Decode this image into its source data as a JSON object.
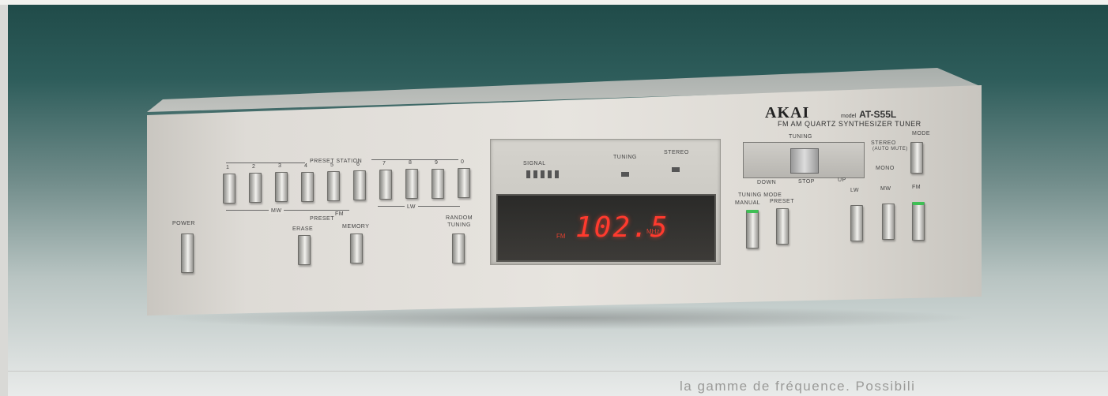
{
  "device": {
    "brand": "AKAI",
    "model_prefix": "model",
    "model": "AT-S55L",
    "subtitle": "FM AM QUARTZ SYNTHESIZER TUNER"
  },
  "labels": {
    "preset_station": "PRESET STATION",
    "power": "POWER",
    "preset": "PRESET",
    "erase": "ERASE",
    "memory": "MEMORY",
    "random_tuning": "RANDOM TUNING",
    "mw": "MW",
    "fm": "FM",
    "lw": "LW",
    "signal": "SIGNAL",
    "tuning": "TUNING",
    "stereo": "STEREO",
    "tuning_dial": "TUNING",
    "down": "DOWN",
    "stop": "STOP",
    "up": "UP",
    "tuning_mode": "TUNING MODE",
    "manual": "MANUAL",
    "preset_mode": "PRESET",
    "mode": "MODE",
    "stereo_mode": "STEREO",
    "auto_mute": "(AUTO MUTE)",
    "mono": "MONO",
    "band_lw": "LW",
    "band_mw": "MW",
    "band_fm": "FM"
  },
  "preset_numbers": [
    "1",
    "2",
    "3",
    "4",
    "5",
    "6",
    "7",
    "8",
    "9",
    "0"
  ],
  "display": {
    "band": "FM",
    "frequency": "102.5",
    "unit": "MHz"
  },
  "caption": "la gamme de fréquence. Possibili"
}
